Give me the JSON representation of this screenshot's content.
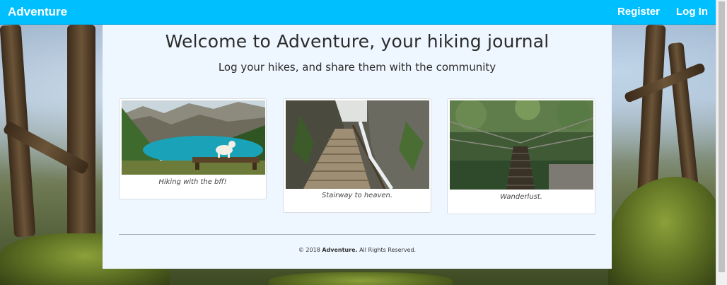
{
  "navbar": {
    "brand": "Adventure",
    "register_label": "Register",
    "login_label": "Log In",
    "color": "#00bfff"
  },
  "hero": {
    "title": "Welcome to Adventure, your hiking journal",
    "subtitle": "Log your hikes, and share them with the community"
  },
  "cards": [
    {
      "caption": "Hiking with the bff!",
      "image": "lake-dog-photo"
    },
    {
      "caption": "Stairway to heaven.",
      "image": "canyon-stairway-photo"
    },
    {
      "caption": "Wanderlust.",
      "image": "rope-bridge-photo"
    }
  ],
  "footer": {
    "prefix": "© 2018 ",
    "brand": "Adventure.",
    "suffix": " All Rights Reserved."
  }
}
